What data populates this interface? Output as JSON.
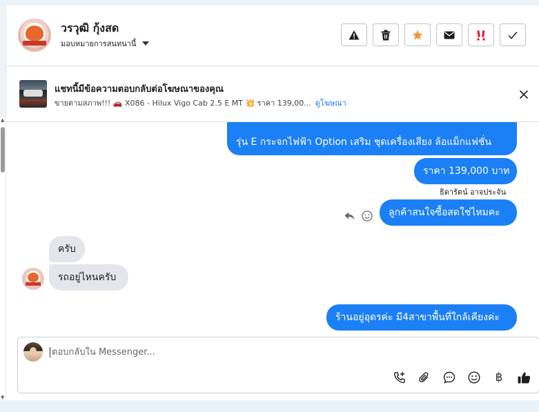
{
  "header": {
    "contact_name": "วรวุฒิ กุ้งสด",
    "assign_label": "มอบหมายการสนทนานี้",
    "tools": [
      {
        "name": "warning-icon",
        "color": "#1c1e21"
      },
      {
        "name": "trash-icon",
        "color": "#1c1e21"
      },
      {
        "name": "star-icon",
        "color": "#f7923b"
      },
      {
        "name": "envelope-icon",
        "color": "#1c1e21"
      },
      {
        "name": "follow-up-icon",
        "color": "#e41e3f"
      },
      {
        "name": "checkmark-icon",
        "color": "#1c1e21"
      }
    ]
  },
  "ad_bar": {
    "title": "แชทนี้มีข้อความตอบกลับต่อโฆษณาของคุณ",
    "subtitle": "ขายตามสภาพ!!! 🚗 X086 - Hilux Vigo Cab 2.5 E MT 💥 ราคา 139,00...",
    "link": "ดูโฆษณา"
  },
  "messages": [
    {
      "direction": "out",
      "text": "รุ่น E กระจกไฟฟ้า Option เสริม ชุดเครื่องเสียง ล้อแม็กแฟชั่น"
    },
    {
      "direction": "out",
      "text": "ราคา 139,000 บาท"
    },
    {
      "direction": "sender",
      "text": "ธิดารัตน์ อาจประจัน"
    },
    {
      "direction": "out",
      "text": "ลูกค้าสนใจซื้อสดใช่ไหมคะ"
    },
    {
      "direction": "in",
      "text": "ครับ"
    },
    {
      "direction": "in",
      "text": "รถอยู่ไหนครับ"
    },
    {
      "direction": "out",
      "text": "ร้านอยู่อุดรค่ะ มี4สาขาพื้นที่ใกล้เคียงค่ะ"
    }
  ],
  "composer": {
    "placeholder": "ตอบกลับใน Messenger...",
    "tools": [
      "phone-plus-icon",
      "paperclip-icon",
      "saved-reply-icon",
      "emoji-icon",
      "baht-icon",
      "thumbs-up-icon"
    ],
    "baht_symbol": "฿"
  },
  "colors": {
    "accent": "#1b7ff5",
    "link": "#1877f2",
    "incoming_bubble": "#e4e6eb"
  }
}
